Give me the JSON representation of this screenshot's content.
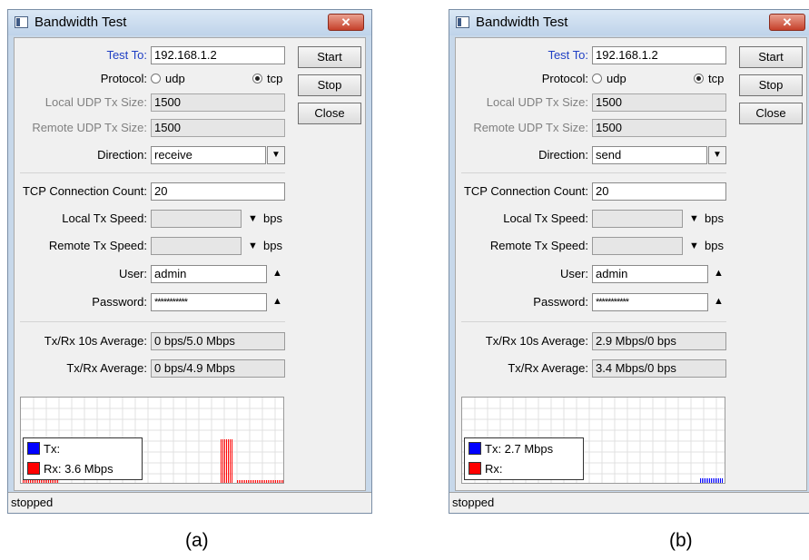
{
  "panels": [
    {
      "id": "a",
      "title": "Bandwidth Test",
      "test_to_label": "Test To:",
      "test_to": "192.168.1.2",
      "protocol_label": "Protocol:",
      "protocol_udp": "udp",
      "protocol_tcp": "tcp",
      "protocol_selected": "tcp",
      "local_udp_label": "Local UDP Tx Size:",
      "local_udp": "1500",
      "remote_udp_label": "Remote UDP Tx Size:",
      "remote_udp": "1500",
      "direction_label": "Direction:",
      "direction": "receive",
      "tcp_count_label": "TCP Connection Count:",
      "tcp_count": "20",
      "local_tx_label": "Local Tx Speed:",
      "remote_tx_label": "Remote Tx Speed:",
      "bps": "bps",
      "user_label": "User:",
      "user": "admin",
      "password_label": "Password:",
      "password": "***********",
      "avg10_label": "Tx/Rx 10s Average:",
      "avg10": "0 bps/5.0 Mbps",
      "avg_label": "Tx/Rx Average:",
      "avg": "0 bps/4.9 Mbps",
      "start": "Start",
      "stop": "Stop",
      "close": "Close",
      "legend_tx": "Tx:",
      "legend_rx": "Rx:  3.6 Mbps",
      "status": "stopped",
      "caption": "(a)"
    },
    {
      "id": "b",
      "title": "Bandwidth Test",
      "test_to_label": "Test To:",
      "test_to": "192.168.1.2",
      "protocol_label": "Protocol:",
      "protocol_udp": "udp",
      "protocol_tcp": "tcp",
      "protocol_selected": "tcp",
      "local_udp_label": "Local UDP Tx Size:",
      "local_udp": "1500",
      "remote_udp_label": "Remote UDP Tx Size:",
      "remote_udp": "1500",
      "direction_label": "Direction:",
      "direction": "send",
      "tcp_count_label": "TCP Connection Count:",
      "tcp_count": "20",
      "local_tx_label": "Local Tx Speed:",
      "remote_tx_label": "Remote Tx Speed:",
      "bps": "bps",
      "user_label": "User:",
      "user": "admin",
      "password_label": "Password:",
      "password": "***********",
      "avg10_label": "Tx/Rx 10s Average:",
      "avg10": "2.9 Mbps/0 bps",
      "avg_label": "Tx/Rx Average:",
      "avg": "3.4 Mbps/0 bps",
      "start": "Start",
      "stop": "Stop",
      "close": "Close",
      "legend_tx": "Tx:  2.7 Mbps",
      "legend_rx": "Rx:",
      "status": "stopped",
      "caption": "(b)"
    }
  ],
  "colors": {
    "tx": "#0000ff",
    "rx": "#ff0000",
    "label_blue": "#1f3fc4",
    "close_red": "#c6402a"
  },
  "icons": {
    "app": "window-icon",
    "close": "close-icon",
    "dropdown": "dropdown-arrow-icon",
    "up": "triangle-up-icon",
    "down": "triangle-down-icon"
  }
}
